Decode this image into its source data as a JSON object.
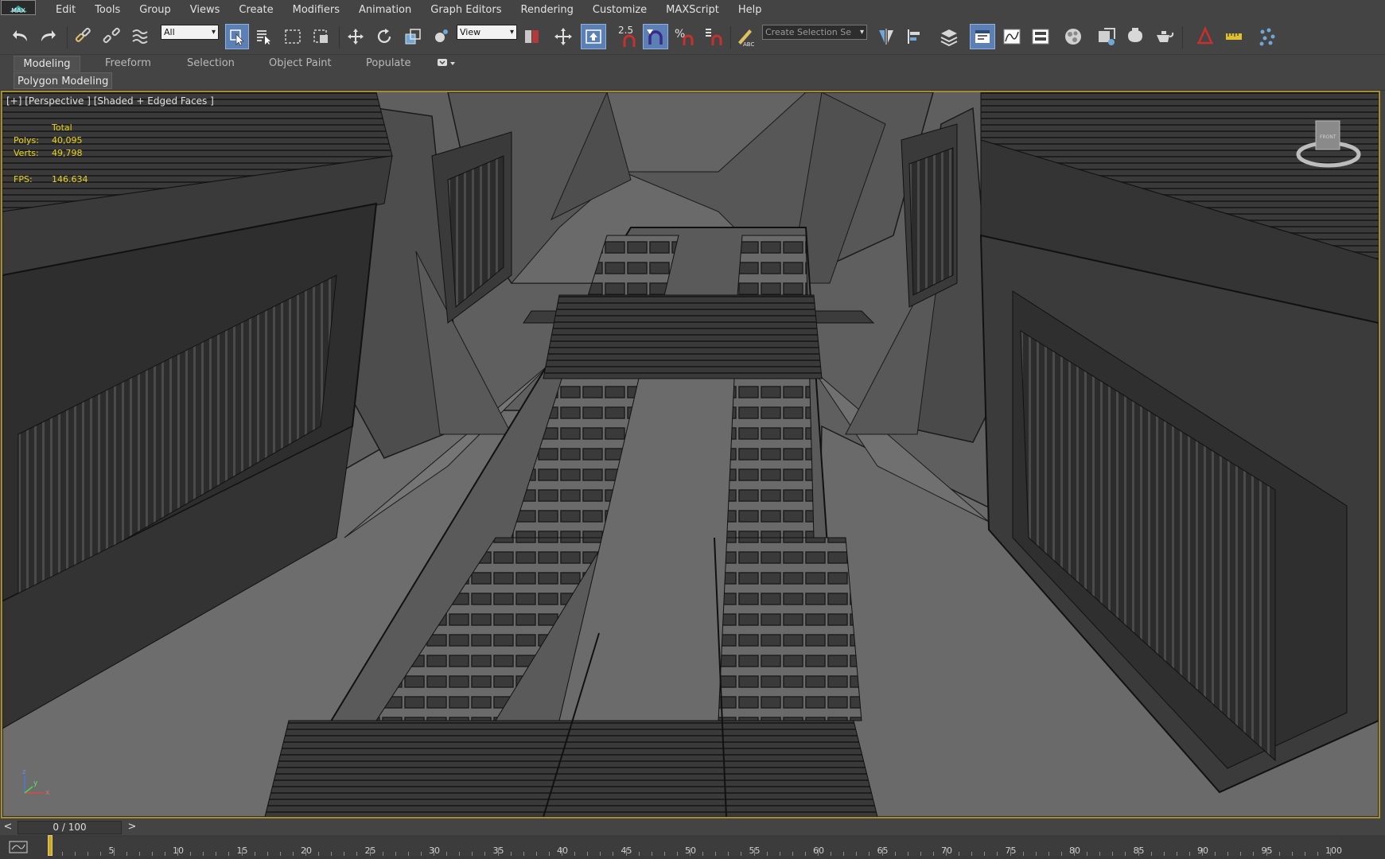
{
  "app": {
    "logo_label": "MAX"
  },
  "menu": [
    "Edit",
    "Tools",
    "Group",
    "Views",
    "Create",
    "Modifiers",
    "Animation",
    "Graph Editors",
    "Rendering",
    "Customize",
    "MAXScript",
    "Help"
  ],
  "toolbar": {
    "selection_filter": "All",
    "reference_coord": "View",
    "angle_snap_value": "2.5",
    "named_selection_placeholder": "Create Selection Se",
    "icons": [
      "undo-icon",
      "redo-icon",
      "link-icon",
      "unlink-icon",
      "bind-space-warp-icon",
      "select-object-icon",
      "select-by-name-icon",
      "rect-selection-region-icon",
      "window-crossing-icon",
      "move-icon",
      "rotate-icon",
      "scale-icon",
      "pivot-icon",
      "select-manipulate-icon",
      "keyboard-shortcut-icon",
      "snaps-toggle-icon",
      "angle-snap-icon",
      "percent-snap-icon",
      "spinner-snap-icon",
      "edit-named-selection-icon",
      "mirror-icon",
      "align-icon",
      "layer-explorer-icon",
      "scene-explorer-icon",
      "curve-editor-icon",
      "schematic-view-icon",
      "material-editor-icon",
      "render-setup-icon",
      "rendered-frame-icon",
      "render-production-icon",
      "render-iterative-icon",
      "scene-converter-icon",
      "measure-icon",
      "populate-icon"
    ]
  },
  "ribbon": {
    "tabs": [
      "Modeling",
      "Freeform",
      "Selection",
      "Object Paint",
      "Populate"
    ],
    "active_tab": "Modeling",
    "panel_label": "Polygon Modeling"
  },
  "viewport": {
    "label": "[+] [Perspective ] [Shaded + Edged Faces ]",
    "stats": {
      "total_label": "Total",
      "polys_label": "Polys:",
      "polys_value": "40,095",
      "verts_label": "Verts:",
      "verts_value": "49,798",
      "fps_label": "FPS:",
      "fps_value": "146.634"
    },
    "viewcube_label": "FRONT",
    "axis": {
      "x": "x",
      "y": "y",
      "z": "z"
    }
  },
  "timeline": {
    "frame_display": "0 / 100",
    "prev": "<",
    "next": ">",
    "ticks": [
      "5",
      "10",
      "15",
      "20",
      "25",
      "30",
      "35",
      "40",
      "45",
      "50",
      "55",
      "60",
      "65",
      "70",
      "75",
      "80",
      "85",
      "90",
      "95",
      "100"
    ]
  },
  "colors": {
    "viewport_border": "#a78c2f",
    "stats_text": "#e8d21b",
    "active_button": "#5c80b4"
  }
}
